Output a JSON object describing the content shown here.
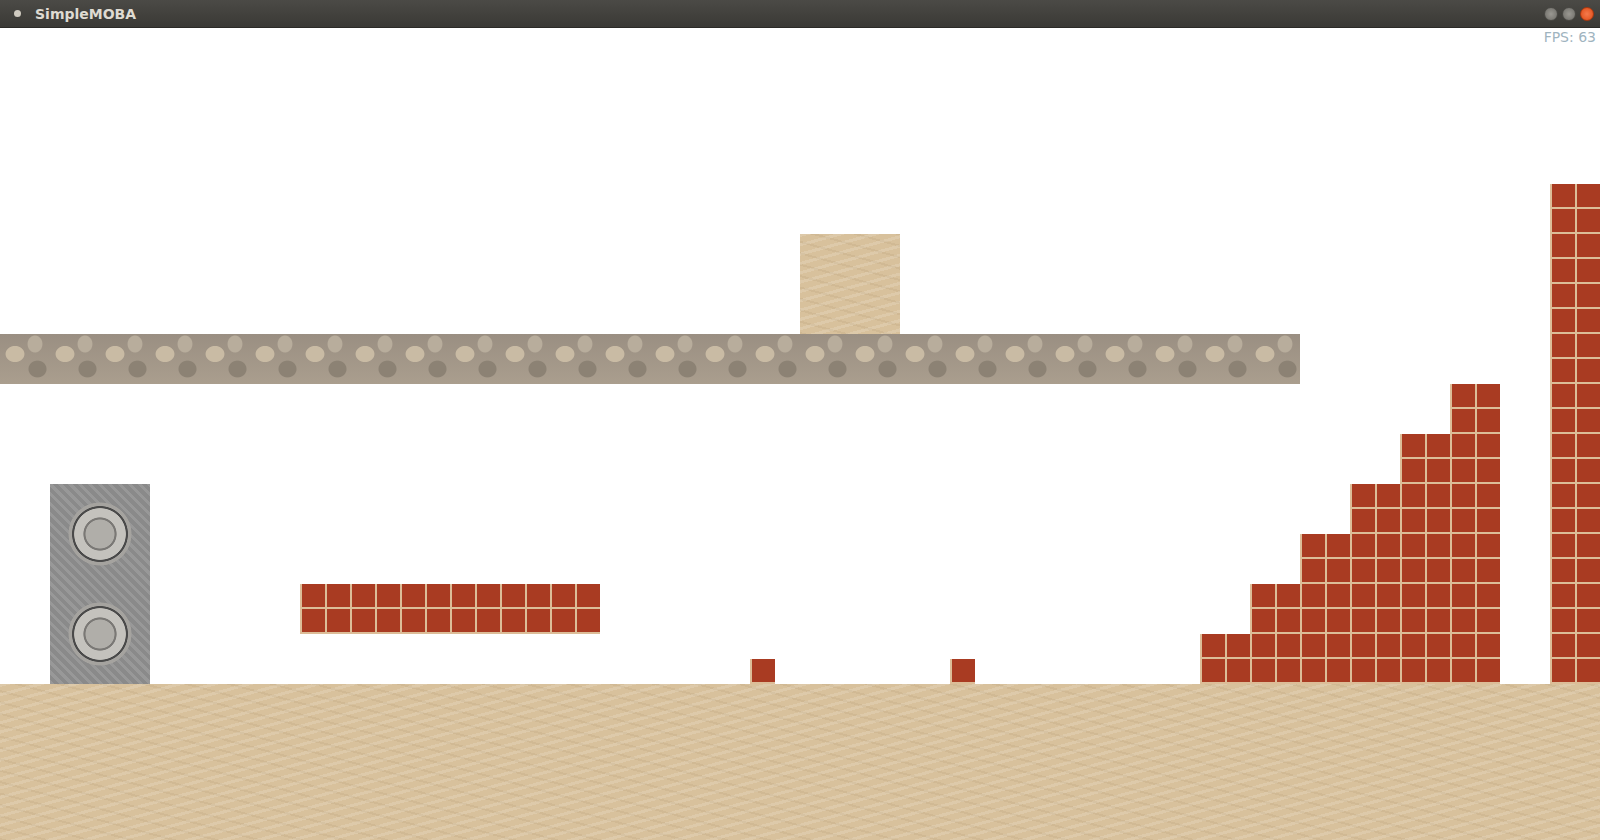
{
  "window": {
    "title": "SimpleMOBA"
  },
  "hud": {
    "fps": "FPS: 63"
  }
}
